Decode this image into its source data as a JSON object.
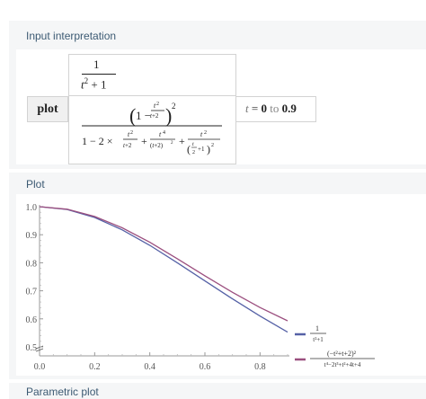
{
  "input_interpretation": {
    "title": "Input interpretation",
    "command": "plot",
    "func1": {
      "num": "1",
      "den_base": "t",
      "den_exp": "2",
      "den_tail": " + 1"
    },
    "func2": {
      "num": "(1 − t²⁄(t+2))²",
      "den": "1 − 2 × t²⁄(t+2) + t⁴⁄(t+2)² + t²⁄(t⁄2 + 1)²"
    },
    "range": {
      "var": "t",
      "eq": " = ",
      "from": "0",
      "to_word": " to ",
      "to": "0.9"
    }
  },
  "plot_pod": {
    "title": "Plot"
  },
  "parametric_pod": {
    "title": "Parametric plot"
  },
  "chart_data": {
    "type": "line",
    "xlim": [
      0,
      0.9
    ],
    "ylim": [
      0.5,
      1.0
    ],
    "x_ticks": [
      "0.0",
      "0.2",
      "0.4",
      "0.6",
      "0.8"
    ],
    "y_ticks": [
      "1.0",
      "0.9",
      "0.8",
      "0.7",
      "0.6",
      "0.5"
    ],
    "grid": false,
    "legend_position": "right",
    "series": [
      {
        "name": "1/(t²+1)",
        "color": "#5561a6",
        "x": [
          0,
          0.1,
          0.2,
          0.3,
          0.4,
          0.5,
          0.6,
          0.7,
          0.8,
          0.9
        ],
        "y": [
          1.0,
          0.9901,
          0.9615,
          0.9174,
          0.8621,
          0.8,
          0.7353,
          0.6711,
          0.6098,
          0.5525
        ]
      },
      {
        "name": "(−t²+t+2)² / (t⁴−2t³+t²+4t+4)",
        "color": "#9b4f7f",
        "x": [
          0,
          0.1,
          0.2,
          0.3,
          0.4,
          0.5,
          0.6,
          0.7,
          0.8,
          0.9
        ],
        "y": [
          1.0,
          0.991,
          0.9652,
          0.9246,
          0.873,
          0.8145,
          0.7535,
          0.6945,
          0.6405,
          0.593
        ]
      }
    ],
    "legend": [
      {
        "num": "1",
        "den": "t²+1",
        "color": "#5561a6"
      },
      {
        "num": "(−t²+t+2)²",
        "den": "t⁴−2t³+t²+4t+4",
        "color": "#9b4f7f"
      }
    ]
  }
}
